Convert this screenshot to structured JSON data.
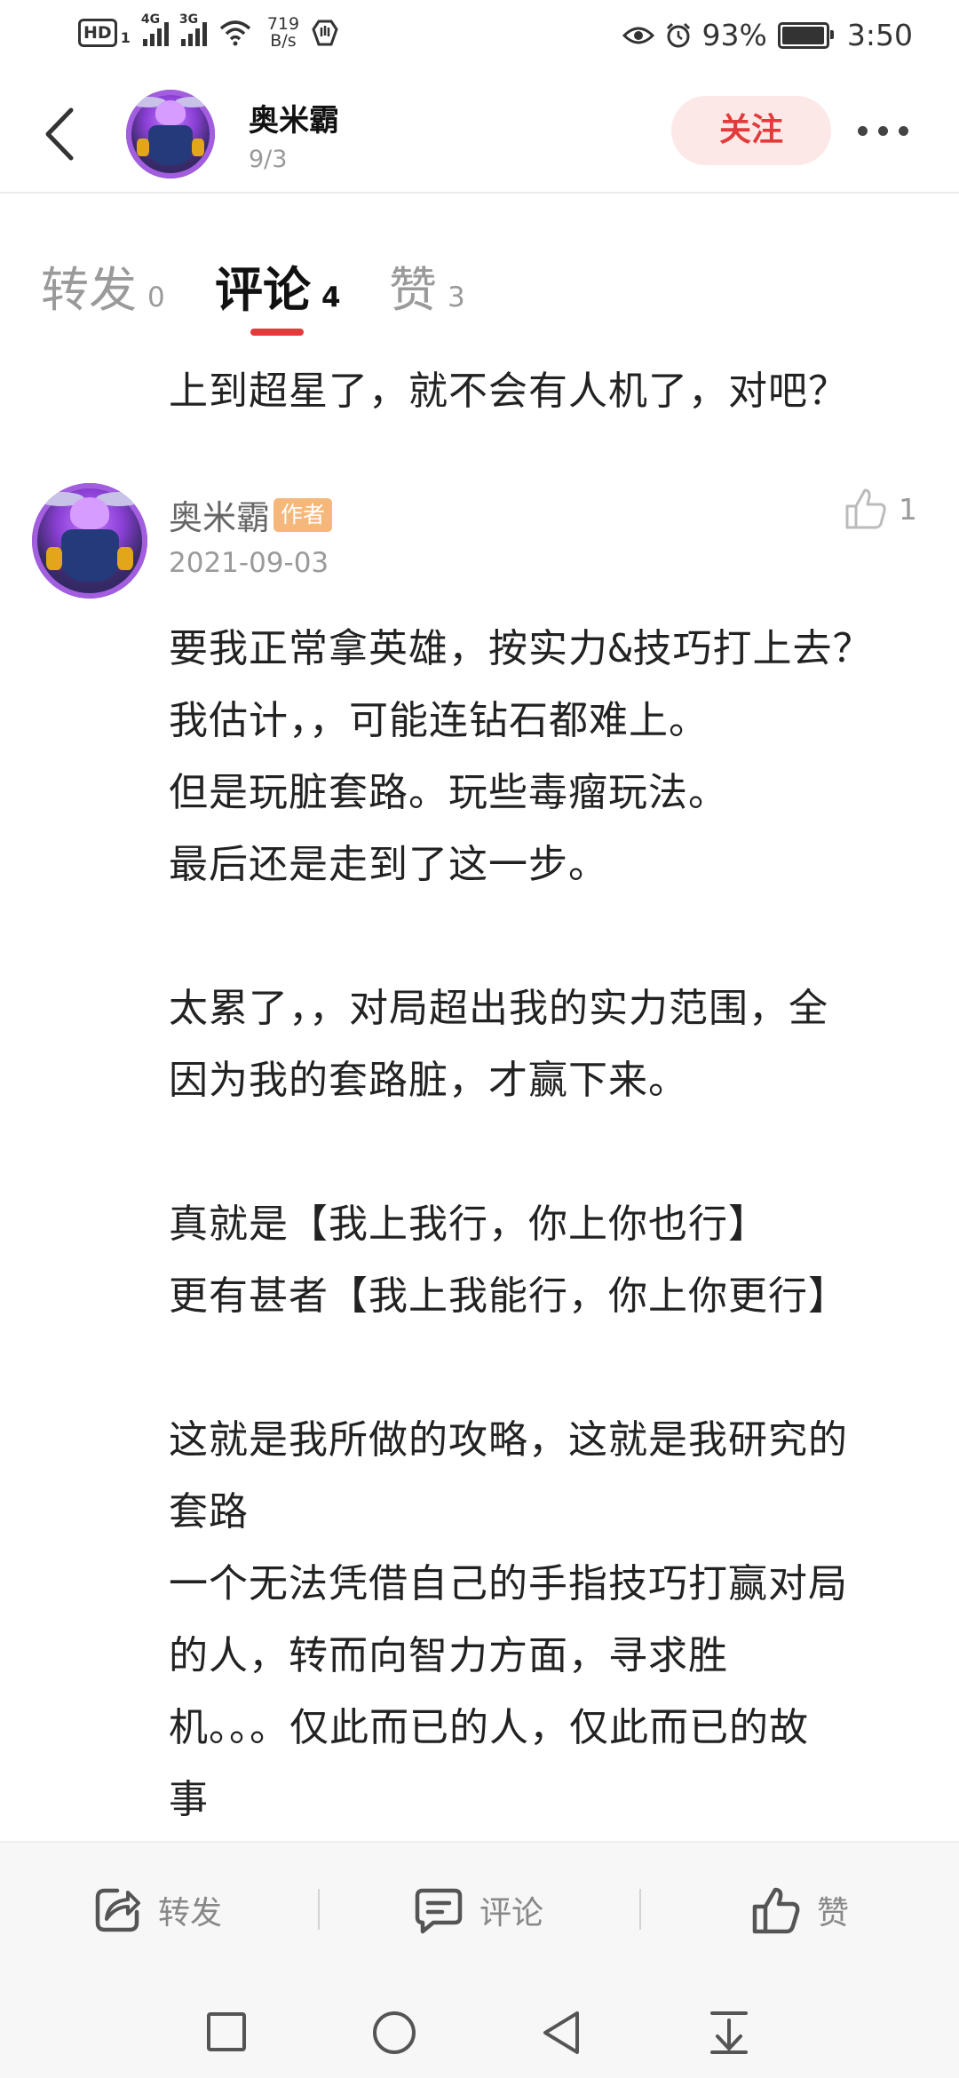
{
  "status_bar": {
    "hd": "HD",
    "sim_sub": "1",
    "sig1": "4G",
    "sig2": "3G",
    "speed_value": "719",
    "speed_unit": "B/s",
    "battery": "93%",
    "time": "3:50"
  },
  "header": {
    "name": "奥米霸",
    "date": "9/3",
    "follow_label": "关注"
  },
  "tabs": [
    {
      "label": "转发",
      "count": "0"
    },
    {
      "label": "评论",
      "count": "4"
    },
    {
      "label": "赞",
      "count": "3"
    }
  ],
  "previous_comment_tail": "上到超星了，就不会有人机了，对吧？",
  "comment": {
    "author": "奥米霸",
    "badge": "作者",
    "date": "2021-09-03",
    "likes": "1",
    "body": "要我正常拿英雄，按实力&技巧打上去？\n我估计，，可能连钻石都难上。\n但是玩脏套路。玩些毒瘤玩法。\n最后还是走到了这一步。\n\n太累了，，对局超出我的实力范围，全\n因为我的套路脏，才赢下来。\n\n真就是【我上我行，你上你也行】\n更有甚者【我上我能行，你上你更行】\n\n这就是我所做的攻略，这就是我研究的\n套路\n一个无法凭借自己的手指技巧打赢对局\n的人，转而向智力方面，寻求胜\n机。。。仅此而已的人，仅此而已的故\n事"
  },
  "action_bar": {
    "forward_label": "转发",
    "comment_label": "评论",
    "like_label": "赞"
  },
  "colors": {
    "accent_red": "#e23b3b",
    "follow_bg": "#fde8e8",
    "badge_bg": "#f6b87a"
  }
}
